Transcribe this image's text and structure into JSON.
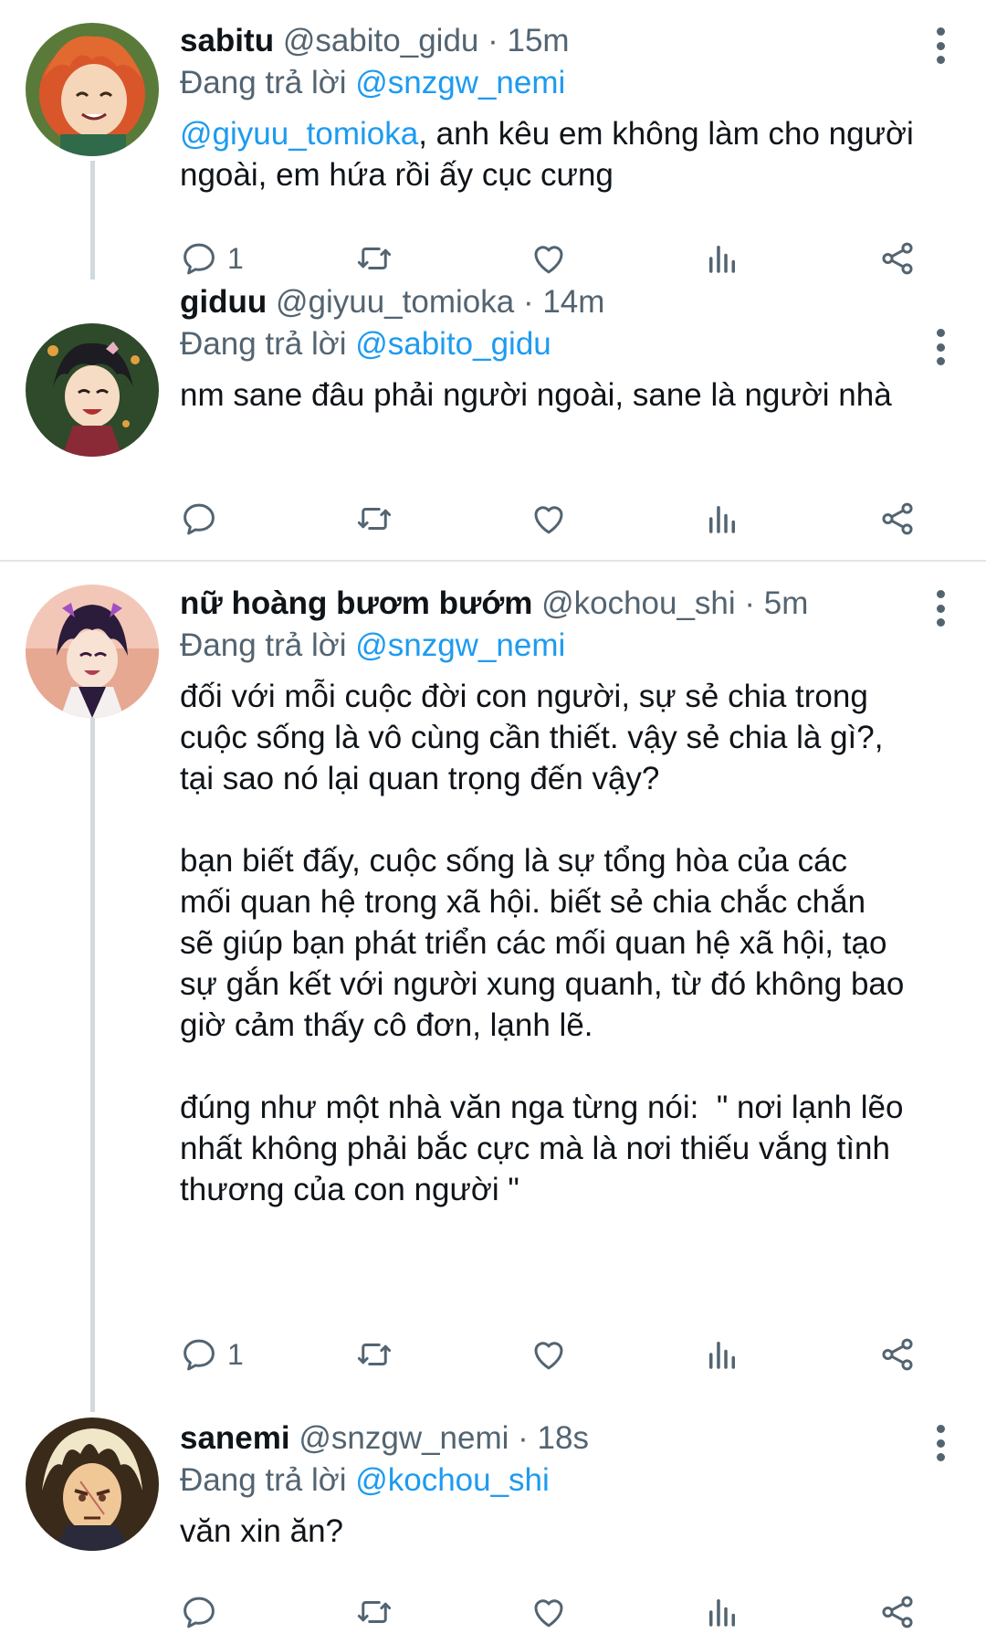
{
  "tweets": [
    {
      "name": "sabitu",
      "handle": "@sabito_gidu",
      "time": "· 15m",
      "replying_label": "Đang trả lời ",
      "replying_to": "@snzgw_nemi",
      "text_mention": "@giyuu_tomioka",
      "text": ", anh kêu em không làm cho người ngoài, em hứa rồi ấy cục cưng",
      "reply_count": "1",
      "avatar": "orange-haired-character"
    },
    {
      "name": "giduu",
      "handle": "@giyuu_tomioka",
      "time": "· 14m",
      "replying_label": "Đang trả lời ",
      "replying_to": "@sabito_gidu",
      "text": "nm sane đâu phải người ngoài, sane là người nhà",
      "reply_count": "",
      "avatar": "dark-haired-character"
    },
    {
      "name": "nữ hoàng bươm bướm",
      "handle": "@kochou_shi",
      "time": "· 5m",
      "replying_label": "Đang trả lời ",
      "replying_to": "@snzgw_nemi",
      "text": "đối với mỗi cuộc đời con người, sự sẻ chia trong\ncuộc sống là vô cùng cần thiết. vậy sẻ chia là gì?,\ntại sao nó lại quan trọng đến vậy?\n\nbạn biết đấy, cuộc sống là sự tổng hòa của các\nmối quan hệ trong xã hội. biết sẻ chia chắc chắn\nsẽ giúp bạn phát triển các mối quan hệ xã hội, tạo\nsự gắn kết với người xung quanh, từ đó không bao\ngiờ cảm thấy cô đơn, lạnh lẽ.\n\nđúng như một nhà văn nga từng nói:  \" nơi lạnh lẽo\nnhất không phải bắc cực mà là nơi thiếu vắng tình\nthương của con người \"",
      "reply_count": "1",
      "avatar": "butterfly-character"
    },
    {
      "name": "sanemi",
      "handle": "@snzgw_nemi",
      "time": "· 18s",
      "replying_label": "Đang trả lời ",
      "replying_to": "@kochou_shi",
      "text": "văn xin ăn?",
      "reply_count": "",
      "avatar": "white-haired-character"
    }
  ],
  "icons": [
    "reply-icon",
    "retweet-icon",
    "like-icon",
    "analytics-icon",
    "share-icon",
    "more-icon"
  ],
  "colors": {
    "link": "#1d9bf0",
    "muted": "#536471",
    "text": "#0f1419",
    "thread_line": "#cfd9de"
  }
}
